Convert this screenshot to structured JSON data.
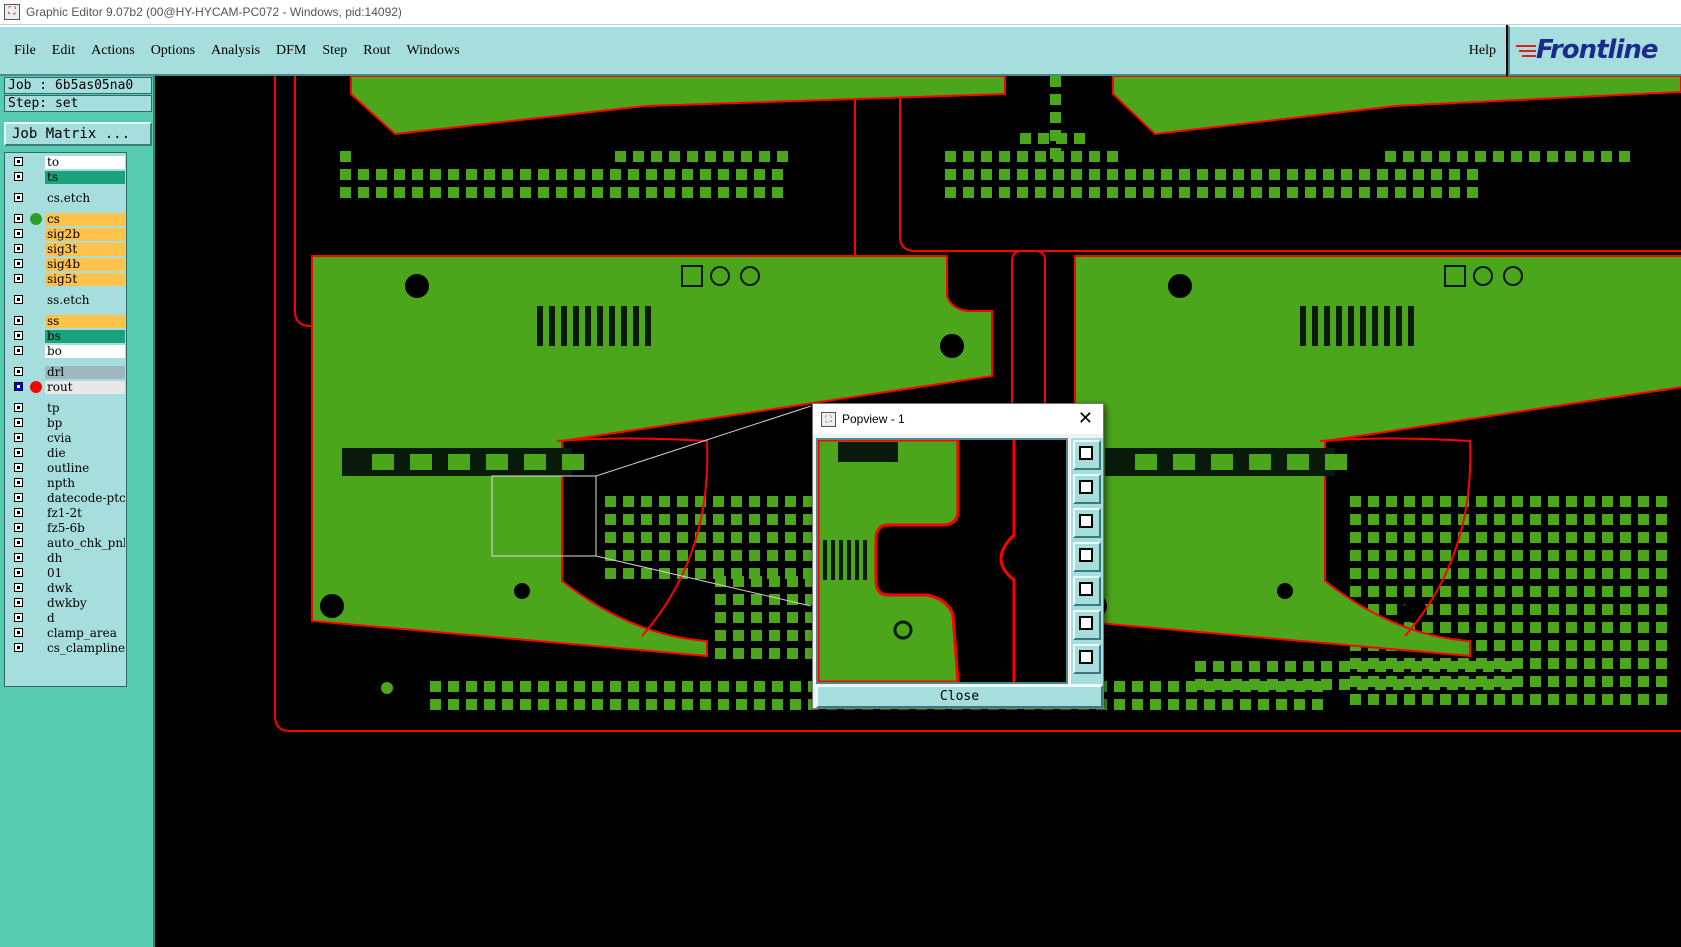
{
  "window": {
    "title": "Graphic Editor 9.07b2 (00@HY-HYCAM-PC072 - Windows, pid:14092)"
  },
  "menu": {
    "items": [
      "File",
      "Edit",
      "Actions",
      "Options",
      "Analysis",
      "DFM",
      "Step",
      "Rout",
      "Windows"
    ],
    "help": "Help"
  },
  "logo": {
    "text": "Frontline"
  },
  "job": {
    "job_label": "Job : 6b5as05na0",
    "step_label": "Step: set",
    "matrix_button": "Job Matrix ..."
  },
  "layers": [
    {
      "name": "to",
      "color": "#ffffff",
      "group": 0
    },
    {
      "name": "ts",
      "color": "#1aa37a",
      "group": 0
    },
    {
      "name": "cs.etch",
      "color": "#a6dede",
      "group": 1
    },
    {
      "name": "cs",
      "color": "#ffc24a",
      "group": 2,
      "marker": "#2aa02a"
    },
    {
      "name": "sig2b",
      "color": "#ffc24a",
      "group": 2
    },
    {
      "name": "sig3t",
      "color": "#ffc24a",
      "group": 2
    },
    {
      "name": "sig4b",
      "color": "#ffc24a",
      "group": 2
    },
    {
      "name": "sig5t",
      "color": "#ffc24a",
      "group": 2
    },
    {
      "name": "ss.etch",
      "color": "#a6dede",
      "group": 3
    },
    {
      "name": "ss",
      "color": "#ffc24a",
      "group": 4
    },
    {
      "name": "bs",
      "color": "#1aa37a",
      "group": 4
    },
    {
      "name": "bo",
      "color": "#ffffff",
      "group": 4
    },
    {
      "name": "drl",
      "color": "#9fb8c0",
      "group": 5
    },
    {
      "name": "rout",
      "color": "#e8e8e8",
      "group": 5,
      "marker": "#ff0000",
      "active": true
    },
    {
      "name": "tp",
      "color": "#a6dede",
      "group": 6
    },
    {
      "name": "bp",
      "color": "#a6dede",
      "group": 6
    },
    {
      "name": "cvia",
      "color": "#a6dede",
      "group": 6
    },
    {
      "name": "die",
      "color": "#a6dede",
      "group": 6
    },
    {
      "name": "outline",
      "color": "#a6dede",
      "group": 6
    },
    {
      "name": "npth",
      "color": "#a6dede",
      "group": 6
    },
    {
      "name": "datecode-ptc",
      "color": "#a6dede",
      "group": 6
    },
    {
      "name": "fz1-2t",
      "color": "#a6dede",
      "group": 6
    },
    {
      "name": "fz5-6b",
      "color": "#a6dede",
      "group": 6
    },
    {
      "name": "auto_chk_pnl",
      "color": "#a6dede",
      "group": 6
    },
    {
      "name": "dh",
      "color": "#a6dede",
      "group": 6
    },
    {
      "name": "01",
      "color": "#a6dede",
      "group": 6
    },
    {
      "name": "dwk",
      "color": "#a6dede",
      "group": 6
    },
    {
      "name": "dwkby",
      "color": "#a6dede",
      "group": 6
    },
    {
      "name": "d",
      "color": "#a6dede",
      "group": 6
    },
    {
      "name": "clamp_area",
      "color": "#a6dede",
      "group": 6
    },
    {
      "name": "cs_clampline",
      "color": "#a6dede",
      "group": 6
    }
  ],
  "popview": {
    "title": "Popview - 1",
    "close_label": "Close"
  },
  "colors": {
    "board": "#4ca61c",
    "outline": "#ff0000",
    "bg": "#000000",
    "ui": "#a6dede",
    "sidebar": "#56cbb0"
  }
}
